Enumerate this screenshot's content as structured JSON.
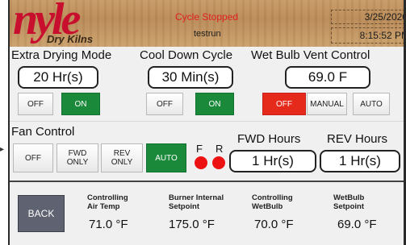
{
  "header": {
    "logo_main": "nyle",
    "logo_sub": "Dry Kilns",
    "cycle_status": "Cycle Stopped",
    "run_name": "testrun",
    "date": "3/25/2020",
    "time": "8:15:52 PM",
    "status_color": "#e0201c",
    "brand_color": "#c8102e"
  },
  "extra_drying": {
    "title": "Extra Drying Mode",
    "value": "20 Hr(s)",
    "off_label": "OFF",
    "on_label": "ON",
    "active": "ON"
  },
  "cool_down": {
    "title": "Cool Down Cycle",
    "value": "30 Min(s)",
    "off_label": "OFF",
    "on_label": "ON",
    "active": "ON"
  },
  "wet_bulb_vent": {
    "title": "Wet Bulb Vent Control",
    "value": "69.0 F",
    "off_label": "OFF",
    "manual_label": "MANUAL",
    "auto_label": "AUTO",
    "active": "OFF"
  },
  "fan_control": {
    "title": "Fan Control",
    "off_label": "OFF",
    "fwd_only_label": "FWD\nONLY",
    "rev_only_label": "REV\nONLY",
    "auto_label": "AUTO",
    "active": "AUTO",
    "f_label": "F",
    "r_label": "R",
    "fwd_hours_title": "FWD Hours",
    "fwd_hours_value": "1 Hr(s)",
    "rev_hours_title": "REV Hours",
    "rev_hours_value": "1 Hr(s)"
  },
  "readings": {
    "back_label": "BACK",
    "items": [
      {
        "label": "Controlling\nAir Temp",
        "value": "71.0 °F"
      },
      {
        "label": "Burner Internal\nSetpoint",
        "value": "175.0 °F"
      },
      {
        "label": "Controlling\nWetBulb",
        "value": "70.0 °F"
      },
      {
        "label": "WetBulb\nSetpoint",
        "value": "69.0 °F"
      }
    ]
  },
  "colors": {
    "on_green": "#1a8a3a",
    "off_red": "#e52a1c",
    "led_red": "#ee1111",
    "back_button": "#5f6270"
  }
}
